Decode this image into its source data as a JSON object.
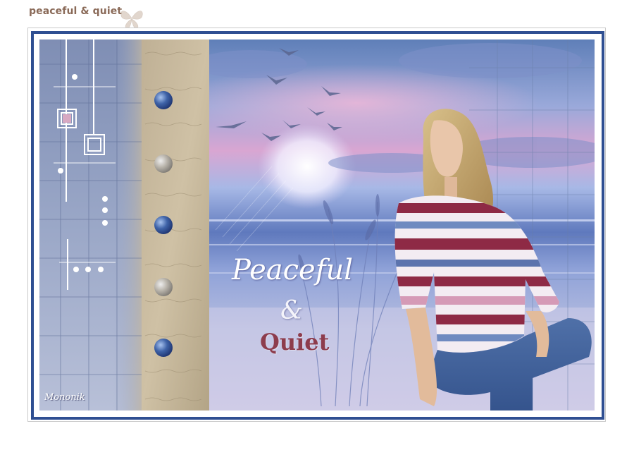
{
  "page": {
    "title": "peaceful & quiet"
  },
  "artwork": {
    "overlay_line1": "Peaceful",
    "overlay_line2": "&",
    "overlay_line3": "Quiet",
    "signature": "Mononik",
    "colors": {
      "frame_blue": "#2f4f92",
      "quiet_red": "#8d3c4c",
      "title_brown": "#8a6a58"
    }
  }
}
